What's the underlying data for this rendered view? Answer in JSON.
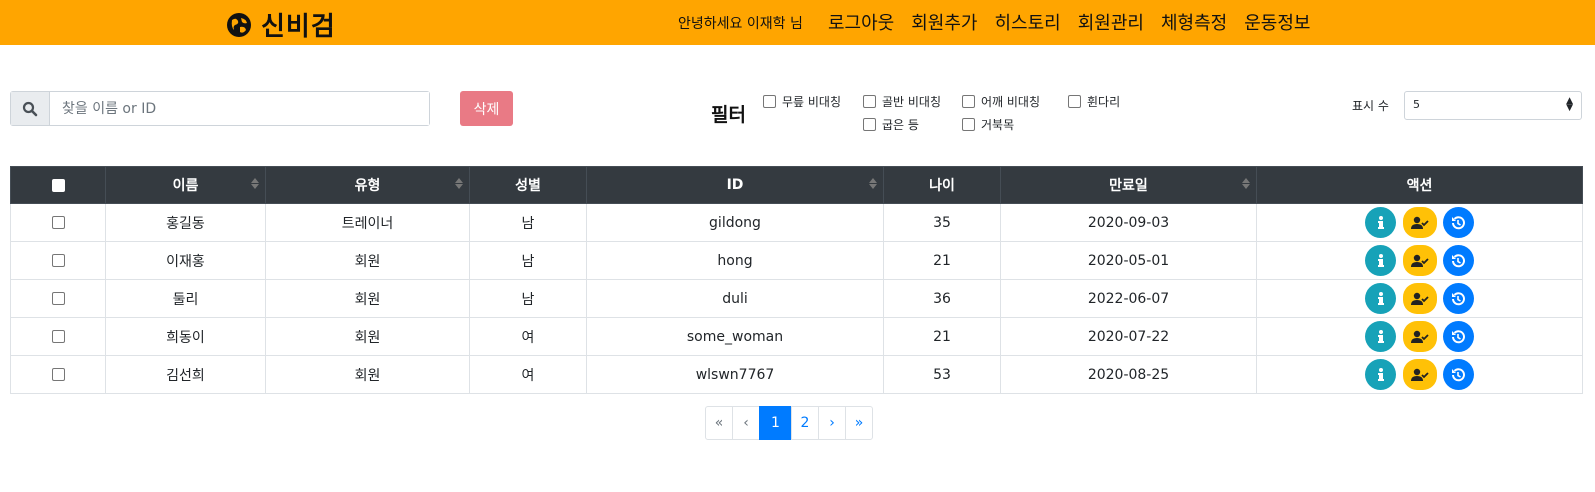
{
  "header": {
    "brand": "신비검",
    "greeting": "안녕하세요 이재학 님",
    "nav": [
      "로그아웃",
      "회원추가",
      "히스토리",
      "회원관리",
      "체형측정",
      "운동정보"
    ]
  },
  "toolbar": {
    "search_placeholder": "찾을 이름 or ID",
    "delete_label": "삭제",
    "filter_title": "필터",
    "filters": [
      "무릎 비대칭",
      "골반 비대칭",
      "어깨 비대칭",
      "휜다리",
      "굽은 등",
      "거북목"
    ],
    "per_page_label": "표시 수",
    "per_page_value": "5"
  },
  "table": {
    "columns": [
      "이름",
      "유형",
      "성별",
      "ID",
      "나이",
      "만료일",
      "액션"
    ],
    "rows": [
      {
        "name": "홍길동",
        "type": "트레이너",
        "gender": "남",
        "id": "gildong",
        "age": "35",
        "expiry": "2020-09-03"
      },
      {
        "name": "이재홍",
        "type": "회원",
        "gender": "남",
        "id": "hong",
        "age": "21",
        "expiry": "2020-05-01"
      },
      {
        "name": "둘리",
        "type": "회원",
        "gender": "남",
        "id": "duli",
        "age": "36",
        "expiry": "2022-06-07"
      },
      {
        "name": "희동이",
        "type": "회원",
        "gender": "여",
        "id": "some_woman",
        "age": "21",
        "expiry": "2020-07-22"
      },
      {
        "name": "김선희",
        "type": "회원",
        "gender": "여",
        "id": "wlswn7767",
        "age": "53",
        "expiry": "2020-08-25"
      }
    ]
  },
  "pagination": {
    "first": "«",
    "prev": "‹",
    "pages": [
      "1",
      "2"
    ],
    "next": "›",
    "last": "»",
    "current": "1"
  },
  "colors": {
    "header_bg": "#ffa500",
    "table_header_bg": "#343a40",
    "delete_button": "#e97a85",
    "info_button": "#17a2b8",
    "user_button": "#ffc107",
    "history_button": "#007bff"
  },
  "icons": {
    "brand": "globe-icon",
    "search": "search-icon",
    "action_info": "info-icon",
    "action_user": "user-check-icon",
    "action_history": "history-icon"
  }
}
